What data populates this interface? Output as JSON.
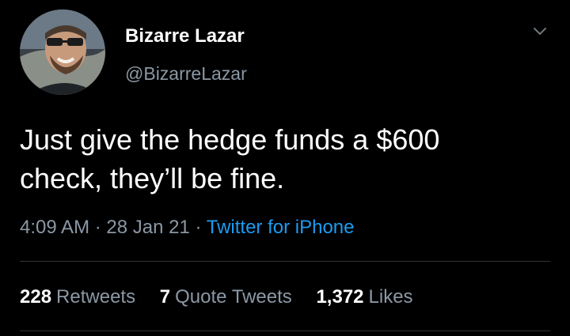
{
  "tweet": {
    "author_name": "Bizarre Lazar",
    "author_handle": "@BizarreLazar",
    "text_lines": [
      "Just give the hedge funds a $600",
      "check, they’ll be fine."
    ],
    "time": "4:09 AM",
    "date": "28 Jan 21",
    "separator": "·",
    "source": "Twitter for iPhone",
    "stats": {
      "retweets_count": "228",
      "retweets_label": "Retweets",
      "quote_tweets_count": "7",
      "quote_tweets_label": "Quote Tweets",
      "likes_count": "1,372",
      "likes_label": "Likes"
    },
    "icons": {
      "more": "chevron-down-icon",
      "avatar": "avatar"
    },
    "colors": {
      "background": "#000000",
      "primary_text": "#ffffff",
      "secondary_text": "#8b98a5",
      "link": "#1d9bf0",
      "divider": "#2f3336"
    }
  }
}
